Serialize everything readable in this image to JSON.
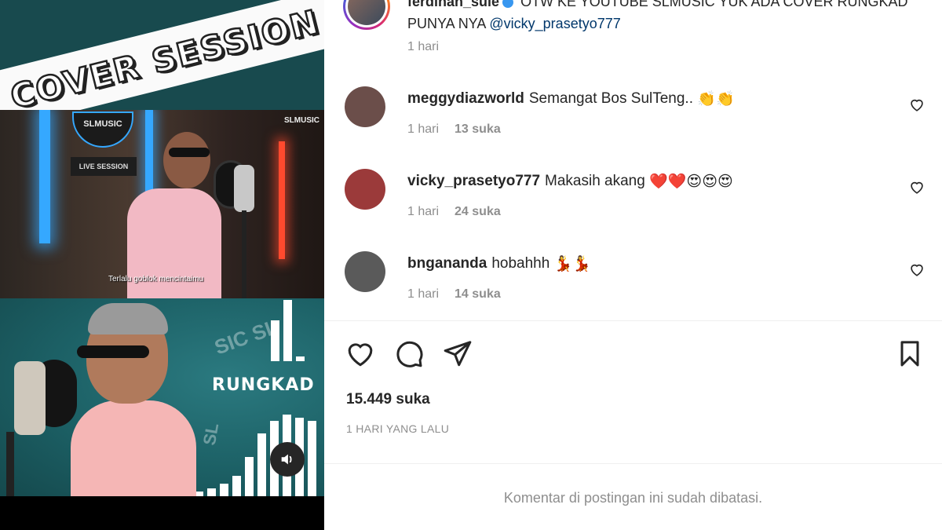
{
  "media": {
    "banner_text": "COVER SESSION",
    "logo_text": "SLMUSIC",
    "live_session": "LIVE SESSION",
    "corner_brand": "SLMUSIC",
    "lyric_caption": "Terlalu goblok mencintaimu",
    "song_title": "RUNGKAD",
    "ghost_brand": "SIC SL",
    "ghost_brand_2": "SL",
    "volume_icon": "speaker-icon"
  },
  "post": {
    "author": "ferdinan_sule",
    "caption": "OTW KE YOUTUBE SLMUSIC YUK ADA COVER RUNGKAD PUNYA NYA",
    "mention": "@vicky_prasetyo777",
    "time": "1 hari"
  },
  "comments": [
    {
      "user": "meggydiazworld",
      "text": "Semangat Bos SulTeng..",
      "emoji": "👏👏",
      "time": "1 hari",
      "likes": "13 suka",
      "avatar_color": "#6b4e4a"
    },
    {
      "user": "vicky_prasetyo777",
      "text": "Makasih akang",
      "emoji": "❤️❤️😍😍😍",
      "time": "1 hari",
      "likes": "24 suka",
      "avatar_color": "#9b3a3a"
    },
    {
      "user": "bngananda",
      "text": "hobahhh",
      "emoji": "💃💃",
      "time": "1 hari",
      "likes": "14 suka",
      "avatar_color": "#5a5a5a"
    }
  ],
  "footer": {
    "likes_total": "15.449 suka",
    "ago": "1 HARI YANG LALU",
    "comments_limited": "Komentar di postingan ini sudah dibatasi."
  },
  "colors": {
    "text_primary": "#262626",
    "text_secondary": "#8e8e8e",
    "mention": "#00376b",
    "divider": "#efefef"
  }
}
